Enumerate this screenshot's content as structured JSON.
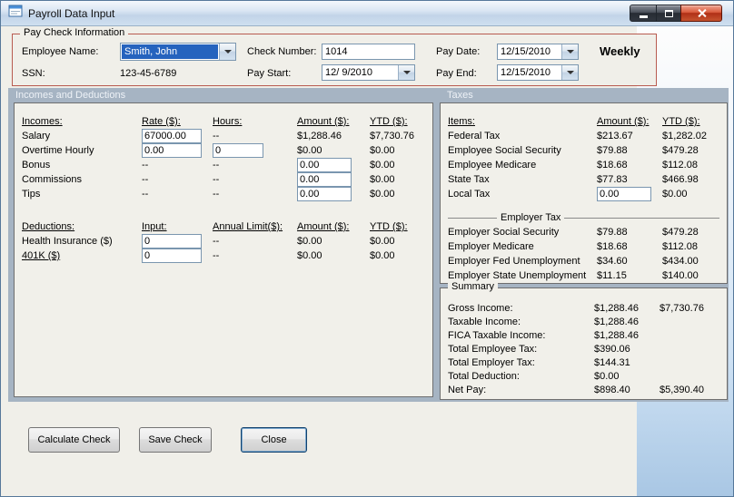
{
  "window": {
    "title": "Payroll Data Input"
  },
  "colors": {
    "selection_highlight": "#2563be",
    "paycheck_border": "#b85b50",
    "panel_background": "#a6b4c3",
    "close_button": "#b03016"
  },
  "paycheck": {
    "legend": "Pay Check Information",
    "employee_name_label": "Employee Name:",
    "employee_name": "Smith, John",
    "ssn_label": "SSN:",
    "ssn": "123-45-6789",
    "check_number_label": "Check Number:",
    "check_number": "1014",
    "pay_start_label": "Pay Start:",
    "pay_start": "12/ 9/2010",
    "pay_date_label": "Pay Date:",
    "pay_date": "12/15/2010",
    "pay_end_label": "Pay End:",
    "pay_end": "12/15/2010",
    "frequency": "Weekly"
  },
  "incomes_panel": {
    "header": "Incomes and Deductions",
    "income_headers": {
      "name": "Incomes:",
      "rate": "Rate ($):",
      "hours": "Hours:",
      "amount": "Amount ($):",
      "ytd": "YTD ($):"
    },
    "incomes": [
      {
        "name": "Salary",
        "rate": "67000.00",
        "hours": "--",
        "amount": "$1,288.46",
        "ytd": "$7,730.76"
      },
      {
        "name": "Overtime Hourly",
        "rate": "0.00",
        "hours": "0",
        "amount": "$0.00",
        "ytd": "$0.00"
      },
      {
        "name": "Bonus",
        "rate": "--",
        "hours": "--",
        "amount": "0.00",
        "ytd": "$0.00"
      },
      {
        "name": "Commissions",
        "rate": "--",
        "hours": "--",
        "amount": "0.00",
        "ytd": "$0.00"
      },
      {
        "name": "Tips",
        "rate": "--",
        "hours": "--",
        "amount": "0.00",
        "ytd": "$0.00"
      }
    ],
    "deduction_headers": {
      "name": "Deductions:",
      "input": "Input:",
      "limit": "Annual Limit($):",
      "amount": "Amount ($):",
      "ytd": "YTD ($):"
    },
    "deductions": [
      {
        "name": "Health Insurance ($)",
        "input": "0",
        "limit": "--",
        "amount": "$0.00",
        "ytd": "$0.00"
      },
      {
        "name": "401K ($)",
        "input": "0",
        "limit": "--",
        "amount": "$0.00",
        "ytd": "$0.00"
      }
    ]
  },
  "taxes_panel": {
    "header": "Taxes",
    "headers": {
      "items": "Items:",
      "amount": "Amount ($):",
      "ytd": "YTD ($):"
    },
    "employee_taxes": [
      {
        "name": "Federal Tax",
        "amount": "$213.67",
        "ytd": "$1,282.02"
      },
      {
        "name": "Employee Social Security",
        "amount": "$79.88",
        "ytd": "$479.28"
      },
      {
        "name": "Employee Medicare",
        "amount": "$18.68",
        "ytd": "$112.08"
      },
      {
        "name": "State Tax",
        "amount": "$77.83",
        "ytd": "$466.98"
      },
      {
        "name": "Local Tax",
        "amount": "0.00",
        "ytd": "$0.00"
      }
    ],
    "employer_label": "Employer Tax",
    "employer_taxes": [
      {
        "name": "Employer Social Security",
        "amount": "$79.88",
        "ytd": "$479.28"
      },
      {
        "name": "Employer Medicare",
        "amount": "$18.68",
        "ytd": "$112.08"
      },
      {
        "name": "Employer Fed Unemployment",
        "amount": "$34.60",
        "ytd": "$434.00"
      },
      {
        "name": "Employer State Unemployment",
        "amount": "$11.15",
        "ytd": "$140.00"
      }
    ]
  },
  "summary": {
    "legend": "Summary",
    "rows": [
      {
        "name": "Gross Income:",
        "value": "$1,288.46",
        "ytd": "$7,730.76"
      },
      {
        "name": "Taxable Income:",
        "value": "$1,288.46",
        "ytd": ""
      },
      {
        "name": "FICA Taxable Income:",
        "value": "$1,288.46",
        "ytd": ""
      },
      {
        "name": "Total Employee Tax:",
        "value": "$390.06",
        "ytd": ""
      },
      {
        "name": "Total Employer Tax:",
        "value": "$144.31",
        "ytd": ""
      },
      {
        "name": "Total Deduction:",
        "value": "$0.00",
        "ytd": ""
      },
      {
        "name": "Net Pay:",
        "value": "$898.40",
        "ytd": "$5,390.40"
      }
    ]
  },
  "buttons": {
    "calculate": "Calculate Check",
    "save": "Save Check",
    "close": "Close"
  }
}
